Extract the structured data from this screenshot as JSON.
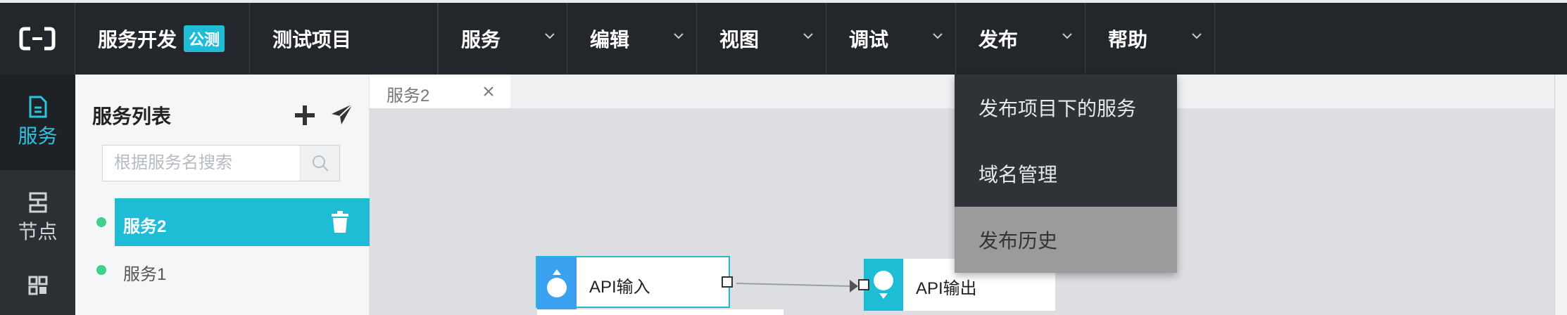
{
  "header": {
    "brand_title": "服务开发",
    "brand_badge": "公测",
    "project_name": "测试项目",
    "menus": [
      {
        "label": "服务"
      },
      {
        "label": "编辑"
      },
      {
        "label": "视图"
      },
      {
        "label": "调试"
      },
      {
        "label": "发布"
      },
      {
        "label": "帮助"
      }
    ]
  },
  "publish_menu": {
    "items": [
      {
        "label": "发布项目下的服务"
      },
      {
        "label": "域名管理"
      },
      {
        "label": "发布历史"
      }
    ]
  },
  "left_nav": {
    "items": [
      {
        "label": "服务",
        "icon": "document-icon",
        "active": true
      },
      {
        "label": "节点",
        "icon": "node-icon",
        "active": false
      },
      {
        "label": "",
        "icon": "grid-icon",
        "active": false
      }
    ]
  },
  "service_panel": {
    "title": "服务列表",
    "search_placeholder": "根据服务名搜索",
    "services": [
      {
        "name": "服务2",
        "selected": true
      },
      {
        "name": "服务1",
        "selected": false
      }
    ]
  },
  "editor": {
    "tab_label": "服务2",
    "nodes": {
      "input_label": "API输入",
      "output_label": "API输出"
    }
  },
  "colors": {
    "accent": "#1fbcd6",
    "topbar": "#23262b",
    "status_dot": "#3fd08f"
  }
}
